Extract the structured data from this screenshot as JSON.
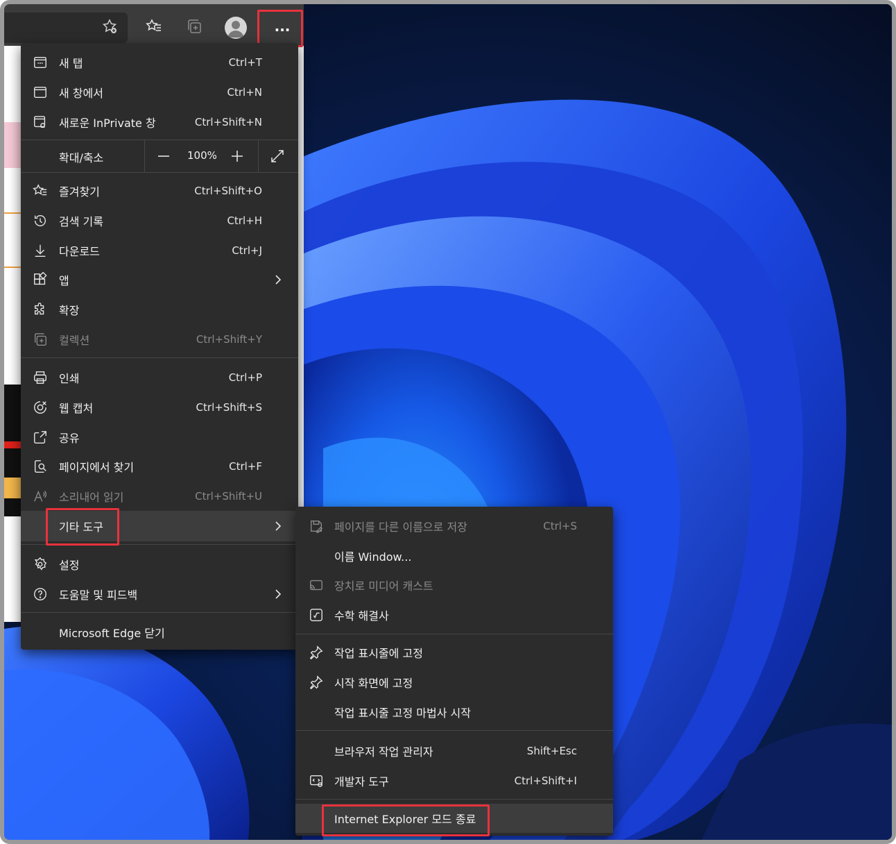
{
  "toolbar": {
    "icons": [
      "add-favorite-icon",
      "favorites-icon",
      "collections-icon",
      "profile-icon",
      "more-icon"
    ],
    "more_label": "···"
  },
  "menu": {
    "items_top": [
      {
        "label": "새 탭",
        "shortcut": "Ctrl+T",
        "icon": "new-tab-icon"
      },
      {
        "label": "새 창에서",
        "shortcut": "Ctrl+N",
        "icon": "new-window-icon"
      },
      {
        "label": "새로운 InPrivate 창",
        "shortcut": "Ctrl+Shift+N",
        "icon": "inprivate-icon"
      }
    ],
    "zoom": {
      "label": "확대/축소",
      "value": "100%"
    },
    "items_mid": [
      {
        "label": "즐겨찾기",
        "shortcut": "Ctrl+Shift+O",
        "icon": "favorites-icon"
      },
      {
        "label": "검색 기록",
        "shortcut": "Ctrl+H",
        "icon": "history-icon"
      },
      {
        "label": "다운로드",
        "shortcut": "Ctrl+J",
        "icon": "download-icon"
      },
      {
        "label": "앱",
        "shortcut": "",
        "icon": "apps-icon"
      },
      {
        "label": "확장",
        "shortcut": "",
        "icon": "extensions-icon"
      },
      {
        "label": "컬렉션",
        "shortcut": "Ctrl+Shift+Y",
        "icon": "collections-icon"
      }
    ],
    "items_tools": [
      {
        "label": "인쇄",
        "shortcut": "Ctrl+P",
        "icon": "print-icon"
      },
      {
        "label": "웹 캡처",
        "shortcut": "Ctrl+Shift+S",
        "icon": "web-capture-icon"
      },
      {
        "label": "공유",
        "shortcut": "",
        "icon": "share-icon"
      },
      {
        "label": "페이지에서 찾기",
        "shortcut": "Ctrl+F",
        "icon": "find-icon"
      },
      {
        "label": "소리내어 읽기",
        "shortcut": "Ctrl+Shift+U",
        "icon": "read-aloud-icon"
      },
      {
        "label": "기타 도구",
        "shortcut": "",
        "icon": ""
      }
    ],
    "items_bottom": [
      {
        "label": "설정",
        "icon": "settings-icon"
      },
      {
        "label": "도움말 및 피드백",
        "icon": "help-icon"
      }
    ],
    "close_label": "Microsoft Edge 닫기"
  },
  "submenu": {
    "items": [
      {
        "label": "페이지를 다른 이름으로 저장",
        "shortcut": "Ctrl+S",
        "icon": "save-as-icon"
      },
      {
        "label": "이름 Window...",
        "shortcut": "",
        "icon": ""
      },
      {
        "label": "장치로 미디어 캐스트",
        "shortcut": "",
        "icon": "cast-icon"
      },
      {
        "label": "수학 해결사",
        "shortcut": "",
        "icon": "math-solver-icon"
      },
      {
        "label": "작업 표시줄에 고정",
        "shortcut": "",
        "icon": "pin-icon"
      },
      {
        "label": "시작 화면에 고정",
        "shortcut": "",
        "icon": "pin-icon"
      },
      {
        "label": "작업 표시줄 고정 마법사 시작",
        "shortcut": "",
        "icon": ""
      },
      {
        "label": "브라우저 작업 관리자",
        "shortcut": "Shift+Esc",
        "icon": ""
      },
      {
        "label": "개발자 도구",
        "shortcut": "Ctrl+Shift+I",
        "icon": "developer-tools-icon"
      },
      {
        "label": "Internet Explorer 모드 종료",
        "shortcut": "",
        "icon": ""
      }
    ]
  },
  "colors": {
    "menu_bg": "#2c2c2c",
    "highlight": "#e8323c",
    "wallpaper": "#0a1630"
  }
}
